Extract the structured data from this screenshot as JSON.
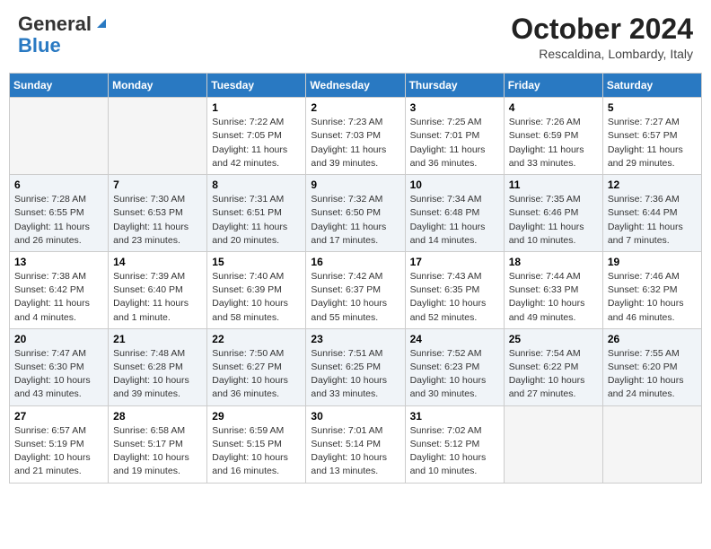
{
  "header": {
    "logo_general": "General",
    "logo_blue": "Blue",
    "month_title": "October 2024",
    "location": "Rescaldina, Lombardy, Italy"
  },
  "weekdays": [
    "Sunday",
    "Monday",
    "Tuesday",
    "Wednesday",
    "Thursday",
    "Friday",
    "Saturday"
  ],
  "weeks": [
    [
      {
        "day": "",
        "info": ""
      },
      {
        "day": "",
        "info": ""
      },
      {
        "day": "1",
        "info": "Sunrise: 7:22 AM\nSunset: 7:05 PM\nDaylight: 11 hours and 42 minutes."
      },
      {
        "day": "2",
        "info": "Sunrise: 7:23 AM\nSunset: 7:03 PM\nDaylight: 11 hours and 39 minutes."
      },
      {
        "day": "3",
        "info": "Sunrise: 7:25 AM\nSunset: 7:01 PM\nDaylight: 11 hours and 36 minutes."
      },
      {
        "day": "4",
        "info": "Sunrise: 7:26 AM\nSunset: 6:59 PM\nDaylight: 11 hours and 33 minutes."
      },
      {
        "day": "5",
        "info": "Sunrise: 7:27 AM\nSunset: 6:57 PM\nDaylight: 11 hours and 29 minutes."
      }
    ],
    [
      {
        "day": "6",
        "info": "Sunrise: 7:28 AM\nSunset: 6:55 PM\nDaylight: 11 hours and 26 minutes."
      },
      {
        "day": "7",
        "info": "Sunrise: 7:30 AM\nSunset: 6:53 PM\nDaylight: 11 hours and 23 minutes."
      },
      {
        "day": "8",
        "info": "Sunrise: 7:31 AM\nSunset: 6:51 PM\nDaylight: 11 hours and 20 minutes."
      },
      {
        "day": "9",
        "info": "Sunrise: 7:32 AM\nSunset: 6:50 PM\nDaylight: 11 hours and 17 minutes."
      },
      {
        "day": "10",
        "info": "Sunrise: 7:34 AM\nSunset: 6:48 PM\nDaylight: 11 hours and 14 minutes."
      },
      {
        "day": "11",
        "info": "Sunrise: 7:35 AM\nSunset: 6:46 PM\nDaylight: 11 hours and 10 minutes."
      },
      {
        "day": "12",
        "info": "Sunrise: 7:36 AM\nSunset: 6:44 PM\nDaylight: 11 hours and 7 minutes."
      }
    ],
    [
      {
        "day": "13",
        "info": "Sunrise: 7:38 AM\nSunset: 6:42 PM\nDaylight: 11 hours and 4 minutes."
      },
      {
        "day": "14",
        "info": "Sunrise: 7:39 AM\nSunset: 6:40 PM\nDaylight: 11 hours and 1 minute."
      },
      {
        "day": "15",
        "info": "Sunrise: 7:40 AM\nSunset: 6:39 PM\nDaylight: 10 hours and 58 minutes."
      },
      {
        "day": "16",
        "info": "Sunrise: 7:42 AM\nSunset: 6:37 PM\nDaylight: 10 hours and 55 minutes."
      },
      {
        "day": "17",
        "info": "Sunrise: 7:43 AM\nSunset: 6:35 PM\nDaylight: 10 hours and 52 minutes."
      },
      {
        "day": "18",
        "info": "Sunrise: 7:44 AM\nSunset: 6:33 PM\nDaylight: 10 hours and 49 minutes."
      },
      {
        "day": "19",
        "info": "Sunrise: 7:46 AM\nSunset: 6:32 PM\nDaylight: 10 hours and 46 minutes."
      }
    ],
    [
      {
        "day": "20",
        "info": "Sunrise: 7:47 AM\nSunset: 6:30 PM\nDaylight: 10 hours and 43 minutes."
      },
      {
        "day": "21",
        "info": "Sunrise: 7:48 AM\nSunset: 6:28 PM\nDaylight: 10 hours and 39 minutes."
      },
      {
        "day": "22",
        "info": "Sunrise: 7:50 AM\nSunset: 6:27 PM\nDaylight: 10 hours and 36 minutes."
      },
      {
        "day": "23",
        "info": "Sunrise: 7:51 AM\nSunset: 6:25 PM\nDaylight: 10 hours and 33 minutes."
      },
      {
        "day": "24",
        "info": "Sunrise: 7:52 AM\nSunset: 6:23 PM\nDaylight: 10 hours and 30 minutes."
      },
      {
        "day": "25",
        "info": "Sunrise: 7:54 AM\nSunset: 6:22 PM\nDaylight: 10 hours and 27 minutes."
      },
      {
        "day": "26",
        "info": "Sunrise: 7:55 AM\nSunset: 6:20 PM\nDaylight: 10 hours and 24 minutes."
      }
    ],
    [
      {
        "day": "27",
        "info": "Sunrise: 6:57 AM\nSunset: 5:19 PM\nDaylight: 10 hours and 21 minutes."
      },
      {
        "day": "28",
        "info": "Sunrise: 6:58 AM\nSunset: 5:17 PM\nDaylight: 10 hours and 19 minutes."
      },
      {
        "day": "29",
        "info": "Sunrise: 6:59 AM\nSunset: 5:15 PM\nDaylight: 10 hours and 16 minutes."
      },
      {
        "day": "30",
        "info": "Sunrise: 7:01 AM\nSunset: 5:14 PM\nDaylight: 10 hours and 13 minutes."
      },
      {
        "day": "31",
        "info": "Sunrise: 7:02 AM\nSunset: 5:12 PM\nDaylight: 10 hours and 10 minutes."
      },
      {
        "day": "",
        "info": ""
      },
      {
        "day": "",
        "info": ""
      }
    ]
  ]
}
